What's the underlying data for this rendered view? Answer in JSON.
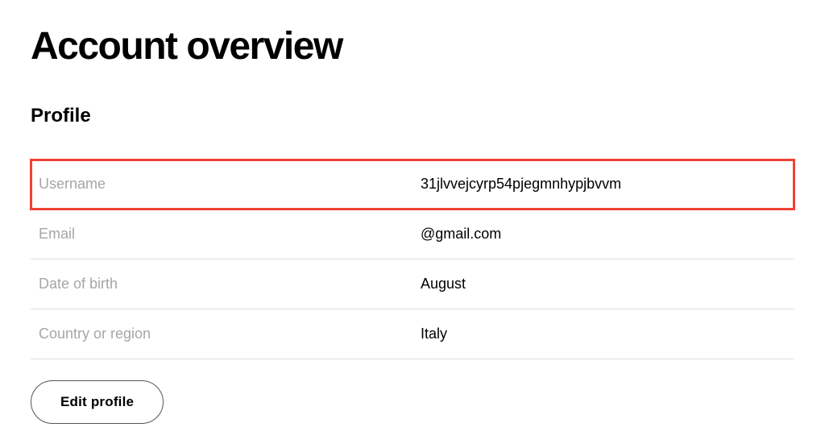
{
  "page_title": "Account overview",
  "section_title": "Profile",
  "profile": {
    "rows": [
      {
        "label": "Username",
        "value": "31jlvvejcyrp54pjegmnhypjbvvm",
        "highlighted": true
      },
      {
        "label": "Email",
        "value": "@gmail.com",
        "highlighted": false
      },
      {
        "label": "Date of birth",
        "value": "August",
        "highlighted": false
      },
      {
        "label": "Country or region",
        "value": "Italy",
        "highlighted": false
      }
    ]
  },
  "edit_button_label": "Edit profile"
}
